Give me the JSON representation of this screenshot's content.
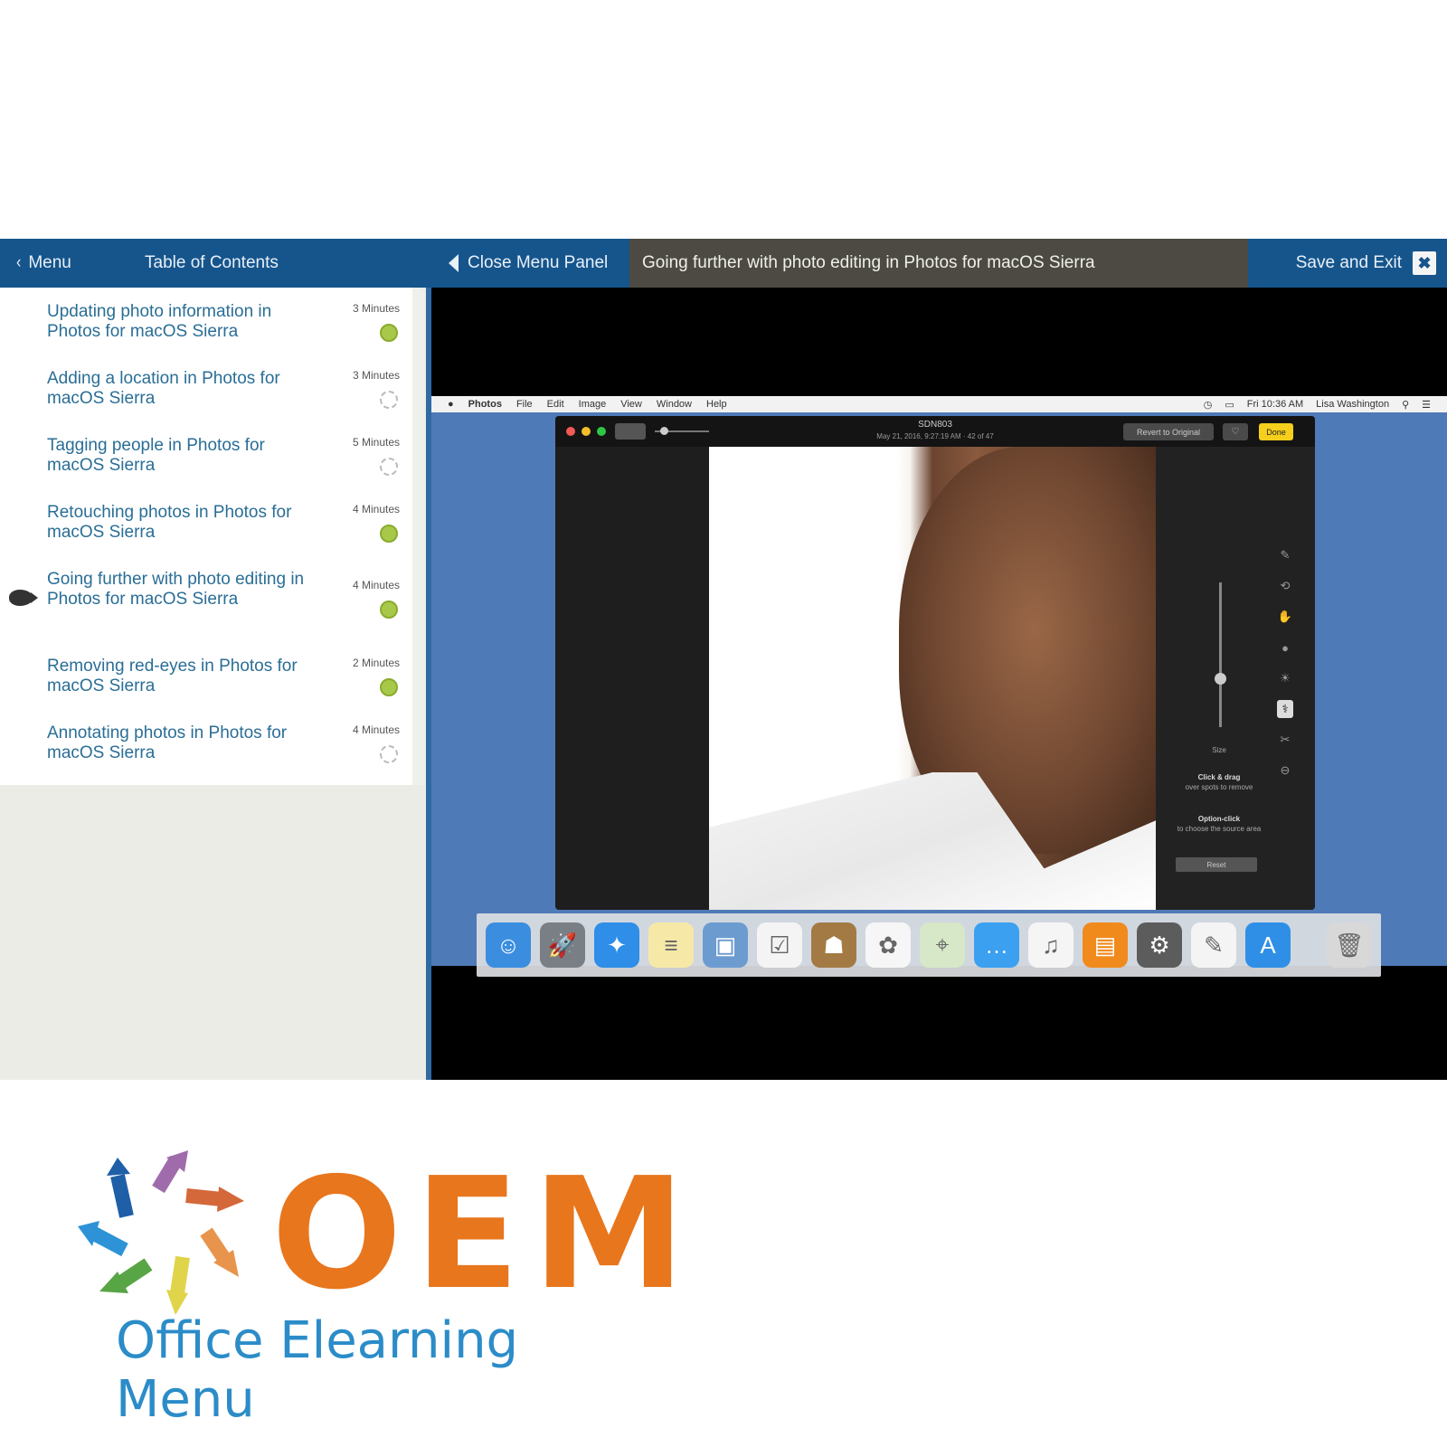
{
  "header": {
    "menu_label": "Menu",
    "toc_title": "Table of Contents",
    "close_panel_label": "Close Menu Panel",
    "lesson_title": "Going further with photo editing in Photos for macOS Sierra",
    "save_exit_label": "Save and Exit",
    "close_icon": "✖"
  },
  "toc": {
    "current_index": 4,
    "items": [
      {
        "title": "Updating photo information in Photos for macOS Sierra",
        "duration": "3 Minutes",
        "status": "completed"
      },
      {
        "title": "Adding a location in Photos for macOS Sierra",
        "duration": "3 Minutes",
        "status": "not-started"
      },
      {
        "title": "Tagging people in Photos for macOS Sierra",
        "duration": "5 Minutes",
        "status": "not-started"
      },
      {
        "title": "Retouching photos in Photos for macOS Sierra",
        "duration": "4 Minutes",
        "status": "completed"
      },
      {
        "title": "Going further with photo editing in Photos for macOS Sierra",
        "duration": "4 Minutes",
        "status": "completed"
      },
      {
        "title": "Removing red-eyes in Photos for macOS Sierra",
        "duration": "2 Minutes",
        "status": "completed"
      },
      {
        "title": "Annotating photos in Photos for macOS Sierra",
        "duration": "4 Minutes",
        "status": "not-started"
      }
    ]
  },
  "video": {
    "menubar": {
      "apple": "",
      "items": [
        "Photos",
        "File",
        "Edit",
        "Image",
        "View",
        "Window",
        "Help"
      ],
      "clock": "Fri 10:36 AM",
      "user": "Lisa Washington"
    },
    "photos_window": {
      "title": "SDN803",
      "subtitle": "May 21, 2016, 9:27:19 AM · 42 of 47",
      "revert_label": "Revert to Original",
      "fav_icon": "♡",
      "done_label": "Done",
      "slider_label": "Size",
      "hint1_title": "Click & drag",
      "hint1_text": "over spots to remove",
      "hint2_title": "Option-click",
      "hint2_text": "to choose the source area",
      "reset_label": "Reset",
      "tools": [
        "✎",
        "⟲",
        "✋",
        "●",
        "☀",
        "⚕",
        "✂",
        "⊖"
      ]
    },
    "dock": [
      "Finder",
      "Launchpad",
      "Safari",
      "Notes",
      "Preview",
      "Reminders",
      "Contacts",
      "Photos",
      "Maps",
      "Messages",
      "iTunes",
      "iBooks",
      "System Preferences",
      "TextEdit",
      "App Store",
      "Trash"
    ]
  },
  "colors": {
    "header_blue": "#16558c",
    "lesson_bar": "#4c4a42",
    "toc_text": "#2a6e96",
    "completed": "#a8c84a",
    "logo_orange": "#e8761d",
    "logo_blue": "#2b8cc8"
  },
  "logo": {
    "mark": "OEM",
    "tagline": "Office Elearning Menu"
  }
}
